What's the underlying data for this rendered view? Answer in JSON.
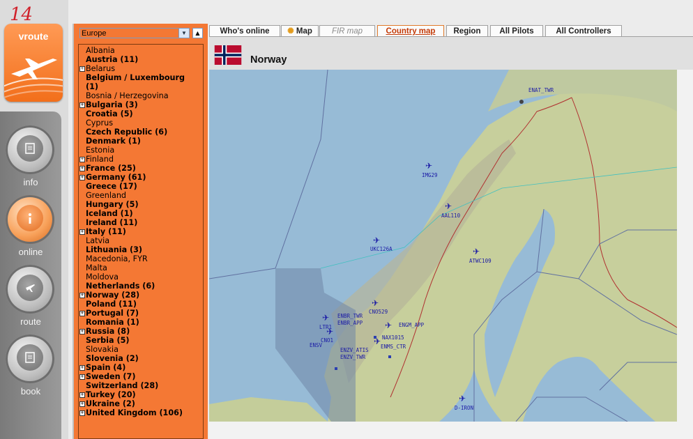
{
  "app": {
    "badge_number": "14",
    "logo_text": "vroute"
  },
  "nav": [
    {
      "label": "info",
      "icon": "info-icon",
      "active": false
    },
    {
      "label": "online",
      "icon": "online-icon",
      "active": true
    },
    {
      "label": "route",
      "icon": "plane-icon",
      "active": false
    },
    {
      "label": "book",
      "icon": "book-icon",
      "active": false
    }
  ],
  "region_select": {
    "value": "Europe"
  },
  "countries": [
    {
      "name": "Albania",
      "bold": false,
      "expand": false
    },
    {
      "name": "Austria (11)",
      "bold": true,
      "expand": false
    },
    {
      "name": "Belarus",
      "bold": false,
      "expand": true
    },
    {
      "name": "Belgium / Luxembourg",
      "bold": true,
      "expand": false
    },
    {
      "name": "(1)",
      "bold": true,
      "expand": false
    },
    {
      "name": "Bosnia / Herzegovina",
      "bold": false,
      "expand": false
    },
    {
      "name": "Bulgaria (3)",
      "bold": true,
      "expand": true
    },
    {
      "name": "Croatia (5)",
      "bold": true,
      "expand": false
    },
    {
      "name": "Cyprus",
      "bold": false,
      "expand": false
    },
    {
      "name": "Czech Republic (6)",
      "bold": true,
      "expand": false
    },
    {
      "name": "Denmark (1)",
      "bold": true,
      "expand": false
    },
    {
      "name": "Estonia",
      "bold": false,
      "expand": false
    },
    {
      "name": "Finland",
      "bold": false,
      "expand": true
    },
    {
      "name": "France (25)",
      "bold": true,
      "expand": true
    },
    {
      "name": "Germany (61)",
      "bold": true,
      "expand": true
    },
    {
      "name": "Greece (17)",
      "bold": true,
      "expand": false
    },
    {
      "name": "Greenland",
      "bold": false,
      "expand": false
    },
    {
      "name": "Hungary (5)",
      "bold": true,
      "expand": false
    },
    {
      "name": "Iceland (1)",
      "bold": true,
      "expand": false
    },
    {
      "name": "Ireland (11)",
      "bold": true,
      "expand": false
    },
    {
      "name": "Italy (11)",
      "bold": true,
      "expand": true
    },
    {
      "name": "Latvia",
      "bold": false,
      "expand": false
    },
    {
      "name": "Lithuania (3)",
      "bold": true,
      "expand": false
    },
    {
      "name": "Macedonia, FYR",
      "bold": false,
      "expand": false
    },
    {
      "name": "Malta",
      "bold": false,
      "expand": false
    },
    {
      "name": "Moldova",
      "bold": false,
      "expand": false
    },
    {
      "name": "Netherlands (6)",
      "bold": true,
      "expand": false
    },
    {
      "name": "Norway (28)",
      "bold": true,
      "expand": true
    },
    {
      "name": "Poland (11)",
      "bold": true,
      "expand": false
    },
    {
      "name": "Portugal (7)",
      "bold": true,
      "expand": true
    },
    {
      "name": "Romania (1)",
      "bold": true,
      "expand": false
    },
    {
      "name": "Russia (8)",
      "bold": true,
      "expand": true
    },
    {
      "name": "Serbia (5)",
      "bold": true,
      "expand": false
    },
    {
      "name": "Slovakia",
      "bold": false,
      "expand": false
    },
    {
      "name": "Slovenia (2)",
      "bold": true,
      "expand": false
    },
    {
      "name": "Spain (4)",
      "bold": true,
      "expand": true
    },
    {
      "name": "Sweden (7)",
      "bold": true,
      "expand": true
    },
    {
      "name": "Switzerland (28)",
      "bold": true,
      "expand": false
    },
    {
      "name": "Turkey (20)",
      "bold": true,
      "expand": true
    },
    {
      "name": "Ukraine (2)",
      "bold": true,
      "expand": true
    },
    {
      "name": "United Kingdom (106)",
      "bold": true,
      "expand": true
    }
  ],
  "tabs": [
    {
      "label": "Who's online",
      "state": "normal"
    },
    {
      "label": "Map",
      "state": "normal",
      "icon": "sun-icon"
    },
    {
      "label": "FIR map",
      "state": "disabled"
    },
    {
      "label": "Country map",
      "state": "selected"
    },
    {
      "label": "Region",
      "state": "normal"
    },
    {
      "label": "All Pilots",
      "state": "normal"
    },
    {
      "label": "All Controllers",
      "state": "normal"
    }
  ],
  "country": {
    "name": "Norway"
  },
  "map_labels": {
    "controllers": [
      "ENAT_TWR",
      "ENBR_TWR",
      "ENBR_APP",
      "ENGM_APP",
      "ENZV_ATIS",
      "ENZV_TWR",
      "ENMS_CTR",
      "ENSV"
    ],
    "flights": [
      "IMG29",
      "AAL110",
      "UKC126A",
      "ATWC109",
      "CNO529",
      "NAX1015",
      "LTR1",
      "CNO1",
      "D-IRON"
    ]
  },
  "colors": {
    "accent": "#f47834",
    "map_water": "#97bbd6",
    "map_land": "#c7cf9c",
    "label_blue": "#1a1aa6"
  }
}
